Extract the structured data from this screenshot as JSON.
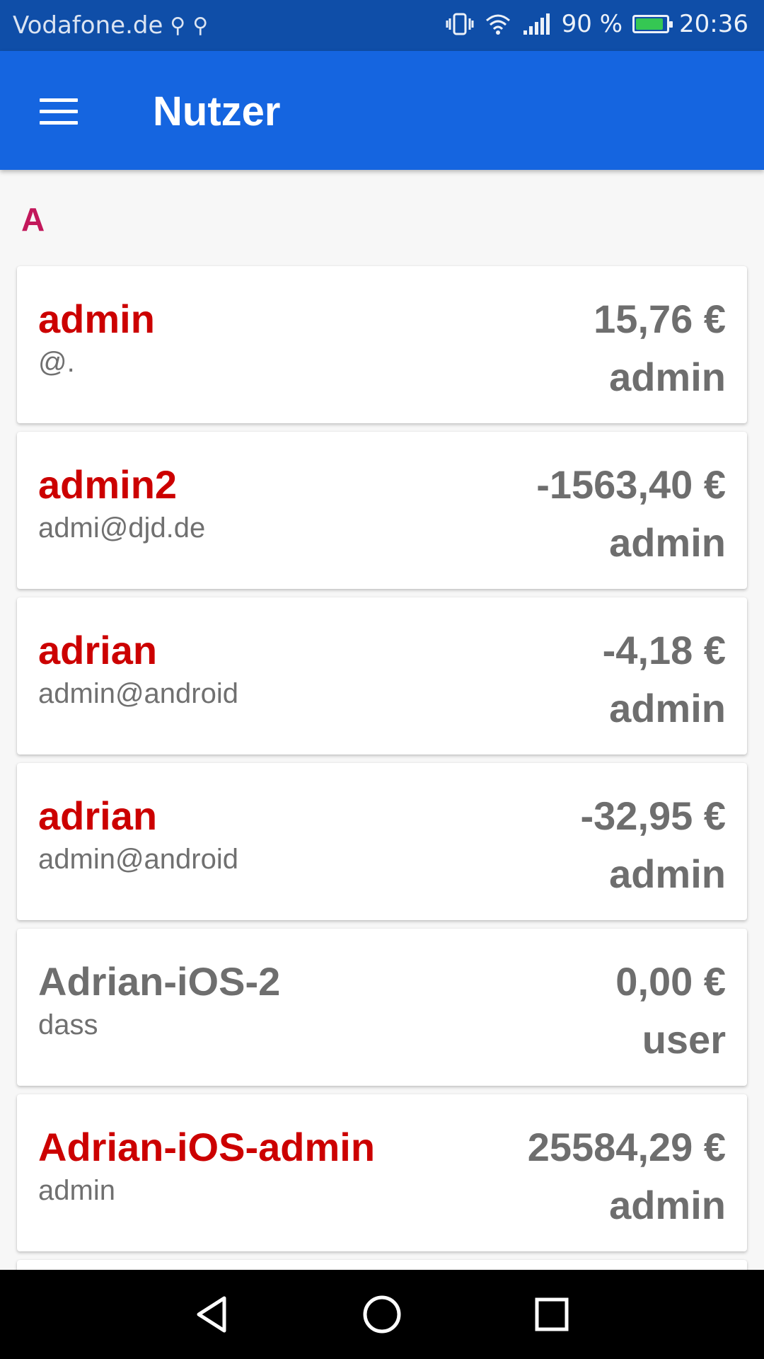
{
  "status_bar": {
    "carrier": "Vodafone.de",
    "signal_percent": "90 %",
    "time": "20:36",
    "battery_level": 0.9,
    "battery_color": "#39d24c"
  },
  "app_bar": {
    "title": "Nutzer",
    "menu_icon": "hamburger-menu-icon",
    "color": "#1565e0"
  },
  "section": {
    "letter": "A"
  },
  "users": [
    {
      "name": "admin",
      "email": "@.",
      "balance": "15,76 €",
      "role": "admin"
    },
    {
      "name": "admin2",
      "email": "admi@djd.de",
      "balance": "-1563,40 €",
      "role": "admin"
    },
    {
      "name": "adrian",
      "email": "admin@android",
      "balance": "-4,18 €",
      "role": "admin"
    },
    {
      "name": "adrian",
      "email": "admin@android",
      "balance": "-32,95 €",
      "role": "admin"
    },
    {
      "name": "Adrian-iOS-2",
      "email": "dass",
      "balance": "0,00 €",
      "role": "user"
    },
    {
      "name": "Adrian-iOS-admin",
      "email": "admin",
      "balance": "25584,29 €",
      "role": "admin"
    }
  ],
  "nav_bar": {
    "back_icon": "back-triangle-icon",
    "home_icon": "home-circle-icon",
    "recents_icon": "recents-square-icon"
  }
}
